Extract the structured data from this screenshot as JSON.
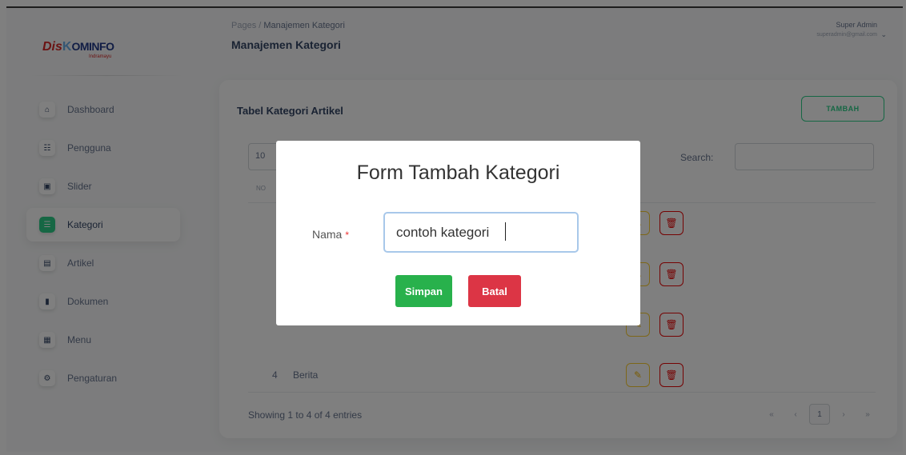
{
  "logo": {
    "dis": "Dis",
    "k": "K",
    "rest": "OMINFO",
    "sub": "Indramayu"
  },
  "sidebar": {
    "items": [
      {
        "label": "Dashboard",
        "icon": "⌂"
      },
      {
        "label": "Pengguna",
        "icon": "☷"
      },
      {
        "label": "Slider",
        "icon": "▣"
      },
      {
        "label": "Kategori",
        "icon": "☰"
      },
      {
        "label": "Artikel",
        "icon": "▤"
      },
      {
        "label": "Dokumen",
        "icon": "▮"
      },
      {
        "label": "Menu",
        "icon": "▦"
      },
      {
        "label": "Pengaturan",
        "icon": "⚙"
      }
    ]
  },
  "header": {
    "breadcrumb_root": "Pages",
    "breadcrumb_sep": "/",
    "breadcrumb_current": "Manajemen Kategori",
    "title": "Manajemen Kategori",
    "user_name": "Super Admin",
    "user_email": "superadmin@gmail.com",
    "chevron": "⌄"
  },
  "card": {
    "title": "Tabel Kategori Artikel",
    "add_button": "TAMBAH",
    "length_value": "10",
    "search_label": "Search:",
    "col_no": "NO",
    "rows": [
      {
        "no": "",
        "name": ""
      },
      {
        "no": "",
        "name": ""
      },
      {
        "no": "",
        "name": ""
      },
      {
        "no": "4",
        "name": "Berita"
      }
    ],
    "info": "Showing 1 to 4 of 4 entries",
    "pager": {
      "first": "«",
      "prev": "‹",
      "current": "1",
      "next": "›",
      "last": "»"
    },
    "edit_icon": "✎",
    "delete_icon": "🗑"
  },
  "modal": {
    "title": "Form Tambah Kategori",
    "field_label": "Nama",
    "required_mark": "*",
    "field_value": "contoh kategori",
    "save_label": "Simpan",
    "cancel_label": "Batal"
  },
  "colors": {
    "accent": "#2dce89",
    "save": "#28b14c",
    "cancel": "#dc3545",
    "edit": "#fbcf33",
    "delete": "#ea0606"
  }
}
